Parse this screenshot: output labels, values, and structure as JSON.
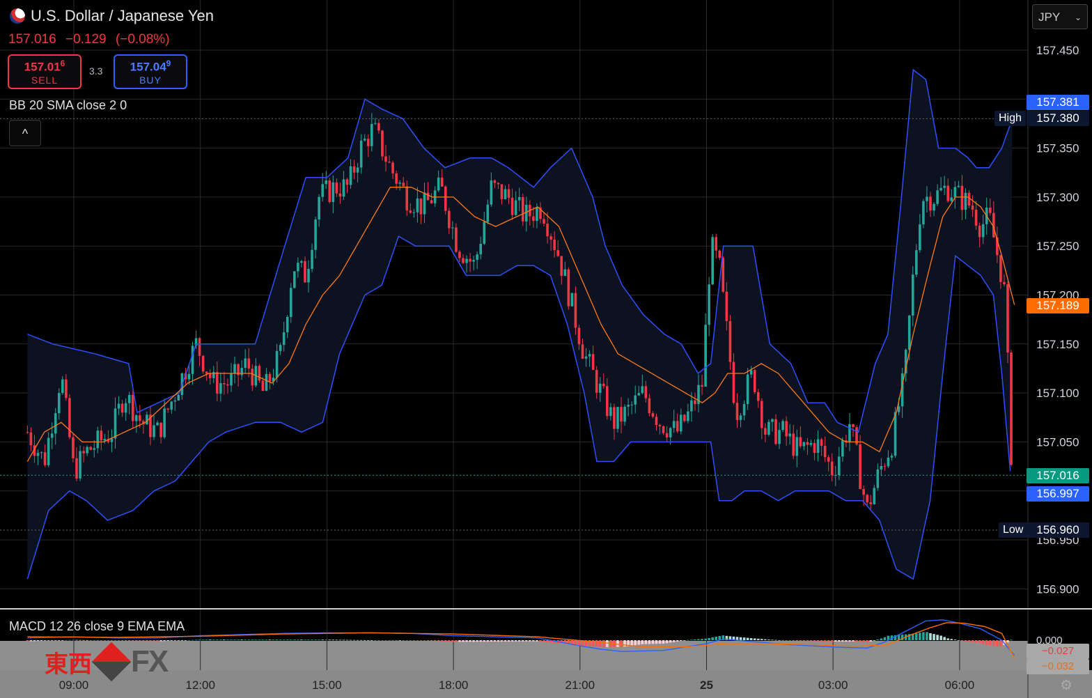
{
  "header": {
    "symbol_title": "U.S. Dollar / Japanese Yen",
    "last_price": "157.016",
    "change": "−0.129",
    "change_pct": "(−0.08%)",
    "sell_price_main": "157.01",
    "sell_price_pip": "6",
    "sell_label": "SELL",
    "buy_price_main": "157.04",
    "buy_price_pip": "9",
    "buy_label": "BUY",
    "spread": "3.3",
    "currency": "JPY"
  },
  "indicators": {
    "bb_label": "BB 20 SMA close 2 0",
    "macd_label": "MACD 12 26 close 9 EMA EMA"
  },
  "price_tags": {
    "upper_band": "157.381",
    "high": "157.380",
    "high_label": "High",
    "basis": "157.189",
    "last": "157.016",
    "lower_band": "156.997",
    "low": "156.960",
    "low_label": "Low",
    "macd_line": "−0.027",
    "macd_signal": "−0.032"
  },
  "colors": {
    "up": "#26a69a",
    "down": "#f23645",
    "band": "#2f4fff",
    "basis": "#ff7a1a",
    "buy": "#2962ff",
    "sell": "#f23645"
  },
  "logo": {
    "kanji": "東西",
    "text": "FX"
  },
  "chart_data": {
    "type": "candlestick",
    "title": "U.S. Dollar / Japanese Yen",
    "ylim": [
      156.87,
      157.49
    ],
    "y_ticks": [
      "157.450",
      "157.400",
      "157.350",
      "157.300",
      "157.250",
      "157.200",
      "157.150",
      "157.100",
      "157.050",
      "157.000",
      "156.950",
      "156.900"
    ],
    "x_ticks": [
      "09:00",
      "12:00",
      "15:00",
      "18:00",
      "21:00",
      "25",
      "03:00",
      "06:00"
    ],
    "x_range_hours": [
      7.9,
      31.3
    ],
    "close_path": [
      [
        7.9,
        157.06
      ],
      [
        8.3,
        157.03
      ],
      [
        8.7,
        157.12
      ],
      [
        9.0,
        157.02
      ],
      [
        9.3,
        157.04
      ],
      [
        9.6,
        157.05
      ],
      [
        9.9,
        157.06
      ],
      [
        10.2,
        157.1
      ],
      [
        10.6,
        157.07
      ],
      [
        11.0,
        157.06
      ],
      [
        11.5,
        157.11
      ],
      [
        11.9,
        157.15
      ],
      [
        12.3,
        157.11
      ],
      [
        12.7,
        157.11
      ],
      [
        13.1,
        157.13
      ],
      [
        13.5,
        157.1
      ],
      [
        13.9,
        157.14
      ],
      [
        14.2,
        157.23
      ],
      [
        14.5,
        157.22
      ],
      [
        14.8,
        157.3
      ],
      [
        15.2,
        157.31
      ],
      [
        15.5,
        157.31
      ],
      [
        15.8,
        157.35
      ],
      [
        16.1,
        157.37
      ],
      [
        16.5,
        157.33
      ],
      [
        16.9,
        157.3
      ],
      [
        17.3,
        157.29
      ],
      [
        17.7,
        157.31
      ],
      [
        18.1,
        157.25
      ],
      [
        18.5,
        157.23
      ],
      [
        18.9,
        157.31
      ],
      [
        19.3,
        157.3
      ],
      [
        19.7,
        157.28
      ],
      [
        20.1,
        157.29
      ],
      [
        20.5,
        157.24
      ],
      [
        20.8,
        157.19
      ],
      [
        21.1,
        157.14
      ],
      [
        21.5,
        157.1
      ],
      [
        21.8,
        157.07
      ],
      [
        22.1,
        157.08
      ],
      [
        22.5,
        157.1
      ],
      [
        22.9,
        157.07
      ],
      [
        23.3,
        157.06
      ],
      [
        23.6,
        157.08
      ],
      [
        23.9,
        157.11
      ],
      [
        24.1,
        157.25
      ],
      [
        24.3,
        157.23
      ],
      [
        24.7,
        157.08
      ],
      [
        25.1,
        157.12
      ],
      [
        25.4,
        157.06
      ],
      [
        25.8,
        157.06
      ],
      [
        26.2,
        157.04
      ],
      [
        26.6,
        157.05
      ],
      [
        27.0,
        157.02
      ],
      [
        27.4,
        157.07
      ],
      [
        27.8,
        156.98
      ],
      [
        28.1,
        157.02
      ],
      [
        28.4,
        157.05
      ],
      [
        28.7,
        157.12
      ],
      [
        28.9,
        157.22
      ],
      [
        29.1,
        157.3
      ],
      [
        29.4,
        157.3
      ],
      [
        29.7,
        157.31
      ],
      [
        30.0,
        157.3
      ],
      [
        30.3,
        157.29
      ],
      [
        30.5,
        157.27
      ],
      [
        30.7,
        157.28
      ],
      [
        30.9,
        157.24
      ],
      [
        31.05,
        157.21
      ],
      [
        31.15,
        157.12
      ],
      [
        31.25,
        157.01
      ],
      [
        31.3,
        157.02
      ]
    ],
    "bollinger_upper": [
      [
        7.9,
        157.16
      ],
      [
        8.5,
        157.15
      ],
      [
        9.5,
        157.14
      ],
      [
        10.3,
        157.13
      ],
      [
        10.5,
        157.08
      ],
      [
        11.0,
        157.09
      ],
      [
        11.5,
        157.1
      ],
      [
        11.9,
        157.15
      ],
      [
        12.5,
        157.15
      ],
      [
        13.3,
        157.15
      ],
      [
        14.0,
        157.25
      ],
      [
        14.5,
        157.32
      ],
      [
        15.0,
        157.32
      ],
      [
        15.5,
        157.34
      ],
      [
        15.9,
        157.4
      ],
      [
        16.3,
        157.39
      ],
      [
        16.8,
        157.38
      ],
      [
        17.3,
        157.35
      ],
      [
        17.8,
        157.33
      ],
      [
        18.4,
        157.34
      ],
      [
        18.9,
        157.34
      ],
      [
        19.3,
        157.33
      ],
      [
        19.9,
        157.31
      ],
      [
        20.3,
        157.33
      ],
      [
        20.8,
        157.35
      ],
      [
        21.3,
        157.3
      ],
      [
        21.6,
        157.25
      ],
      [
        22.0,
        157.21
      ],
      [
        22.5,
        157.18
      ],
      [
        23.0,
        157.16
      ],
      [
        23.4,
        157.15
      ],
      [
        23.8,
        157.12
      ],
      [
        24.1,
        157.13
      ],
      [
        24.4,
        157.25
      ],
      [
        24.8,
        157.25
      ],
      [
        25.1,
        157.25
      ],
      [
        25.5,
        157.15
      ],
      [
        26.0,
        157.13
      ],
      [
        26.4,
        157.09
      ],
      [
        26.8,
        157.09
      ],
      [
        27.1,
        157.07
      ],
      [
        27.6,
        157.06
      ],
      [
        28.0,
        157.13
      ],
      [
        28.3,
        157.16
      ],
      [
        28.6,
        157.29
      ],
      [
        28.9,
        157.43
      ],
      [
        29.2,
        157.42
      ],
      [
        29.5,
        157.35
      ],
      [
        29.9,
        157.35
      ],
      [
        30.2,
        157.34
      ],
      [
        30.4,
        157.33
      ],
      [
        30.7,
        157.33
      ],
      [
        31.0,
        157.35
      ],
      [
        31.25,
        157.38
      ]
    ],
    "bollinger_lower": [
      [
        7.9,
        156.91
      ],
      [
        8.4,
        156.98
      ],
      [
        8.9,
        157.0
      ],
      [
        9.3,
        156.99
      ],
      [
        9.8,
        156.97
      ],
      [
        10.4,
        156.98
      ],
      [
        10.9,
        157.0
      ],
      [
        11.4,
        157.01
      ],
      [
        11.8,
        157.03
      ],
      [
        12.2,
        157.05
      ],
      [
        12.6,
        157.06
      ],
      [
        13.3,
        157.07
      ],
      [
        13.9,
        157.07
      ],
      [
        14.4,
        157.06
      ],
      [
        14.9,
        157.07
      ],
      [
        15.3,
        157.14
      ],
      [
        15.6,
        157.17
      ],
      [
        15.9,
        157.2
      ],
      [
        16.3,
        157.21
      ],
      [
        16.7,
        157.26
      ],
      [
        17.1,
        157.25
      ],
      [
        17.5,
        157.25
      ],
      [
        17.9,
        157.25
      ],
      [
        18.3,
        157.22
      ],
      [
        18.7,
        157.22
      ],
      [
        19.1,
        157.22
      ],
      [
        19.5,
        157.23
      ],
      [
        19.9,
        157.23
      ],
      [
        20.3,
        157.22
      ],
      [
        20.7,
        157.17
      ],
      [
        21.1,
        157.1
      ],
      [
        21.4,
        157.03
      ],
      [
        21.8,
        157.03
      ],
      [
        22.2,
        157.05
      ],
      [
        22.6,
        157.05
      ],
      [
        23.0,
        157.05
      ],
      [
        23.4,
        157.05
      ],
      [
        23.8,
        157.05
      ],
      [
        24.1,
        157.05
      ],
      [
        24.3,
        156.99
      ],
      [
        24.6,
        156.99
      ],
      [
        24.9,
        157.0
      ],
      [
        25.3,
        157.0
      ],
      [
        25.7,
        156.99
      ],
      [
        26.1,
        157.0
      ],
      [
        26.5,
        157.0
      ],
      [
        26.9,
        157.0
      ],
      [
        27.3,
        156.99
      ],
      [
        27.7,
        156.99
      ],
      [
        28.1,
        156.97
      ],
      [
        28.5,
        156.92
      ],
      [
        28.9,
        156.91
      ],
      [
        29.3,
        156.99
      ],
      [
        29.6,
        157.12
      ],
      [
        29.9,
        157.24
      ],
      [
        30.2,
        157.23
      ],
      [
        30.5,
        157.22
      ],
      [
        30.8,
        157.2
      ],
      [
        31.0,
        157.12
      ],
      [
        31.2,
        157.02
      ]
    ],
    "bollinger_basis": [
      [
        7.9,
        157.03
      ],
      [
        8.3,
        157.06
      ],
      [
        8.7,
        157.07
      ],
      [
        9.2,
        157.05
      ],
      [
        9.7,
        157.05
      ],
      [
        10.2,
        157.06
      ],
      [
        10.7,
        157.07
      ],
      [
        11.2,
        157.09
      ],
      [
        11.7,
        157.11
      ],
      [
        12.2,
        157.12
      ],
      [
        12.7,
        157.12
      ],
      [
        13.2,
        157.12
      ],
      [
        13.7,
        157.11
      ],
      [
        14.1,
        157.13
      ],
      [
        14.5,
        157.17
      ],
      [
        14.9,
        157.2
      ],
      [
        15.3,
        157.22
      ],
      [
        15.7,
        157.25
      ],
      [
        16.1,
        157.28
      ],
      [
        16.5,
        157.31
      ],
      [
        17.0,
        157.31
      ],
      [
        17.5,
        157.3
      ],
      [
        18.0,
        157.3
      ],
      [
        18.5,
        157.28
      ],
      [
        19.0,
        157.27
      ],
      [
        19.5,
        157.28
      ],
      [
        20.0,
        157.29
      ],
      [
        20.5,
        157.27
      ],
      [
        20.8,
        157.24
      ],
      [
        21.1,
        157.21
      ],
      [
        21.5,
        157.17
      ],
      [
        21.9,
        157.14
      ],
      [
        22.3,
        157.13
      ],
      [
        22.7,
        157.12
      ],
      [
        23.1,
        157.11
      ],
      [
        23.5,
        157.1
      ],
      [
        23.9,
        157.09
      ],
      [
        24.2,
        157.1
      ],
      [
        24.5,
        157.12
      ],
      [
        24.9,
        157.12
      ],
      [
        25.3,
        157.13
      ],
      [
        25.7,
        157.12
      ],
      [
        26.1,
        157.1
      ],
      [
        26.5,
        157.08
      ],
      [
        26.9,
        157.06
      ],
      [
        27.3,
        157.05
      ],
      [
        27.7,
        157.05
      ],
      [
        28.1,
        157.04
      ],
      [
        28.5,
        157.08
      ],
      [
        28.9,
        157.16
      ],
      [
        29.3,
        157.23
      ],
      [
        29.6,
        157.28
      ],
      [
        29.9,
        157.3
      ],
      [
        30.2,
        157.3
      ],
      [
        30.5,
        157.29
      ],
      [
        30.8,
        157.27
      ],
      [
        31.0,
        157.24
      ],
      [
        31.3,
        157.19
      ]
    ],
    "macd_line": [
      [
        7.9,
        0.004
      ],
      [
        9.0,
        0.006
      ],
      [
        10.0,
        0.004
      ],
      [
        11.0,
        0.004
      ],
      [
        12.0,
        0.008
      ],
      [
        13.0,
        0.01
      ],
      [
        14.0,
        0.012
      ],
      [
        15.0,
        0.013
      ],
      [
        16.0,
        0.013
      ],
      [
        17.0,
        0.012
      ],
      [
        18.0,
        0.008
      ],
      [
        19.0,
        0.006
      ],
      [
        20.0,
        0.004
      ],
      [
        21.0,
        -0.01
      ],
      [
        21.5,
        -0.016
      ],
      [
        22.0,
        -0.02
      ],
      [
        23.0,
        -0.018
      ],
      [
        24.0,
        -0.006
      ],
      [
        24.4,
        0.002
      ],
      [
        25.0,
        -0.002
      ],
      [
        26.0,
        -0.008
      ],
      [
        27.0,
        -0.012
      ],
      [
        27.8,
        -0.014
      ],
      [
        28.2,
        -0.004
      ],
      [
        28.7,
        0.015
      ],
      [
        29.2,
        0.034
      ],
      [
        29.6,
        0.036
      ],
      [
        30.0,
        0.03
      ],
      [
        30.5,
        0.02
      ],
      [
        31.0,
        0.0
      ],
      [
        31.3,
        -0.027
      ]
    ],
    "macd_signal": [
      [
        7.9,
        0.006
      ],
      [
        10.0,
        0.005
      ],
      [
        12.0,
        0.007
      ],
      [
        14.0,
        0.011
      ],
      [
        16.0,
        0.013
      ],
      [
        18.0,
        0.011
      ],
      [
        20.0,
        0.006
      ],
      [
        21.5,
        -0.004
      ],
      [
        22.5,
        -0.012
      ],
      [
        23.5,
        -0.012
      ],
      [
        24.5,
        -0.006
      ],
      [
        25.5,
        -0.006
      ],
      [
        26.5,
        -0.008
      ],
      [
        27.5,
        -0.011
      ],
      [
        28.3,
        -0.008
      ],
      [
        28.8,
        0.008
      ],
      [
        29.3,
        0.022
      ],
      [
        29.7,
        0.031
      ],
      [
        30.1,
        0.03
      ],
      [
        30.6,
        0.024
      ],
      [
        31.0,
        0.012
      ],
      [
        31.3,
        -0.032
      ]
    ],
    "macd_ylim": [
      -0.045,
      0.045
    ]
  }
}
